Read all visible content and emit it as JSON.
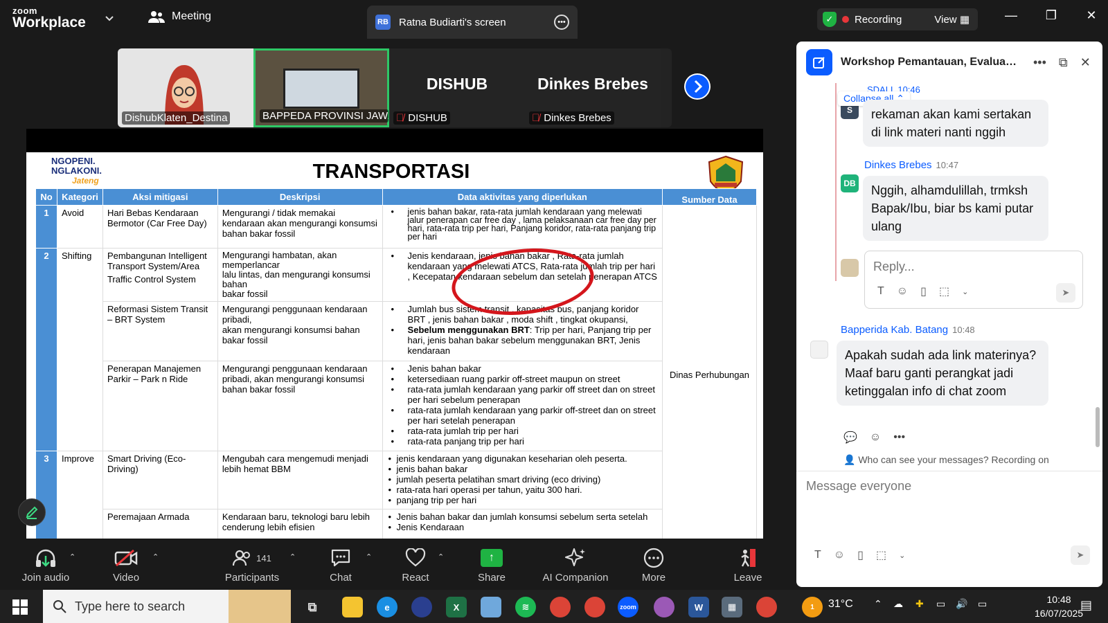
{
  "topbar": {
    "logo_line1": "zoom",
    "logo_line2": "Workplace",
    "meeting_label": "Meeting",
    "share_tab": {
      "initials": "RB",
      "label": "Ratna Budiarti's screen"
    },
    "recording_label": "Recording",
    "view_label": "View"
  },
  "gallery": {
    "tiles": [
      {
        "name": "DishubKlaten_Destina"
      },
      {
        "name": "BAPPEDA PROVINSI JAW..."
      },
      {
        "title": "DISHUB",
        "name": "DISHUB"
      },
      {
        "title": "Dinkes Brebes",
        "name": "Dinkes Brebes"
      }
    ]
  },
  "slide": {
    "logo_line1": "NGOPENI.",
    "logo_line2": "NGLAKONI.",
    "logo_line3": "Jateng",
    "title": "TRANSPORTASI",
    "headers": [
      "No",
      "Kategori",
      "Aksi mitigasi",
      "Deskripsi",
      "Data aktivitas yang diperlukan",
      "Sumber Data"
    ],
    "source": "Dinas Perhubungan",
    "rows": [
      {
        "no": "1",
        "kategori": "Avoid",
        "aksi": "Hari Bebas Kendaraan Bermotor (Car Free Day)",
        "deskripsi": "Mengurangi / tidak memakai kendaraan akan mengurangi konsumsi bahan bakar fossil",
        "data": [
          "jenis bahan bakar, rata-rata jumlah kendaraan yang melewati jalur penerapan car free day , lama pelaksanaan car free day per hari, rata-rata trip per hari, Panjang koridor, rata-rata panjang trip per hari"
        ]
      },
      {
        "no": "2",
        "kategori": "Shifting",
        "aksi": "Pembangunan Intelligent Transport System/Area",
        "aksi2": "Traffic Control System",
        "deskripsi": "Mengurangi hambatan, akan memperlancar",
        "deskripsi2": "lalu lintas, dan mengurangi konsumsi bahan",
        "deskripsi3": "bakar fossil",
        "data": [
          "Jenis kendaraan, jenis bahan bakar , Rata-rata jumlah kendaraan yang melewati ATCS, Rata-rata jumlah trip per hari , Kecepatan kendaraan sebelum dan setelah penerapan ATCS"
        ]
      },
      {
        "aksi": "Reformasi Sistem Transit – BRT System",
        "deskripsi": "Mengurangi penggunaan kendaraan pribadi,",
        "deskripsi2": "akan mengurangi konsumsi bahan bakar fossil",
        "data": [
          "Jumlah bus sistem transit , kapasitas bus, panjang koridor BRT , jenis bahan bakar , moda shift , tingkat okupansi,"
        ],
        "data_bold": "Sebelum menggunakan BRT",
        "data_bold_rest": ": Trip per hari, Panjang trip per hari, jenis bahan bakar sebelum menggunakan BRT, Jenis kendaraan"
      },
      {
        "aksi": "Penerapan Manajemen Parkir – Park n Ride",
        "deskripsi": "Mengurangi penggunaan kendaraan pribadi, akan mengurangi konsumsi bahan bakar fossil",
        "data": [
          "Jenis bahan bakar",
          "ketersediaan ruang parkir off-street maupun on street",
          "rata-rata jumlah kendaraan yang parkir off street dan on street per hari sebelum penerapan",
          "rata-rata jumlah kendaraan yang parkir off-street dan on street per hari setelah penerapan",
          "rata-rata jumlah trip per hari",
          "rata-rata panjang trip per hari"
        ]
      },
      {
        "no": "3",
        "kategori": "Improve",
        "aksi": "Smart Driving (Eco-Driving)",
        "deskripsi": "Mengubah cara mengemudi menjadi lebih hemat BBM",
        "data": [
          "jenis kendaraan yang digunakan keseharian oleh peserta.",
          "jenis bahan bakar",
          "jumlah peserta pelatihan smart driving (eco driving)",
          "rata-rata hari operasi per tahun, yaitu 300 hari.",
          "panjang trip per hari"
        ]
      },
      {
        "aksi": "Peremajaan Armada",
        "deskripsi": "Kendaraan baru, teknologi baru lebih cenderung lebih efisien",
        "data": [
          "Jenis bahan bakar dan jumlah konsumsi sebelum serta setelah",
          "Jenis Kendaraan"
        ]
      }
    ]
  },
  "toolbar": {
    "join_audio": "Join audio",
    "video": "Video",
    "participants": "Participants",
    "participants_count": "141",
    "chat": "Chat",
    "react": "React",
    "share": "Share",
    "ai_companion": "AI Companion",
    "more": "More",
    "leave": "Leave"
  },
  "chat": {
    "title": "Workshop Pemantauan, Evaluas...",
    "collapse_label": "Collapse all",
    "ghost_sender": "SDALL",
    "ghost_time": "10:46",
    "ghost_initial": "S",
    "msg1": "rekaman akan kami sertakan di link materi nanti nggih",
    "sender2": "Dinkes Brebes",
    "time2": "10:47",
    "initials2": "DB",
    "msg2": "Nggih, alhamdulillah, trmksh Bapak/Ibu, biar bs kami putar ulang",
    "reply_placeholder": "Reply...",
    "sender3": "Bapperida Kab. Batang",
    "time3": "10:48",
    "msg3": "Apakah sudah ada link materinya? Maaf baru ganti perangkat jadi ketinggalan info di chat zoom",
    "who_can_see": "Who can see your messages? Recording on",
    "message_placeholder": "Message everyone"
  },
  "taskbar": {
    "search_placeholder": "Type here to search",
    "weather": "31°C",
    "weather_badge": "1",
    "time": "10:48",
    "date": "16/07/2025"
  }
}
